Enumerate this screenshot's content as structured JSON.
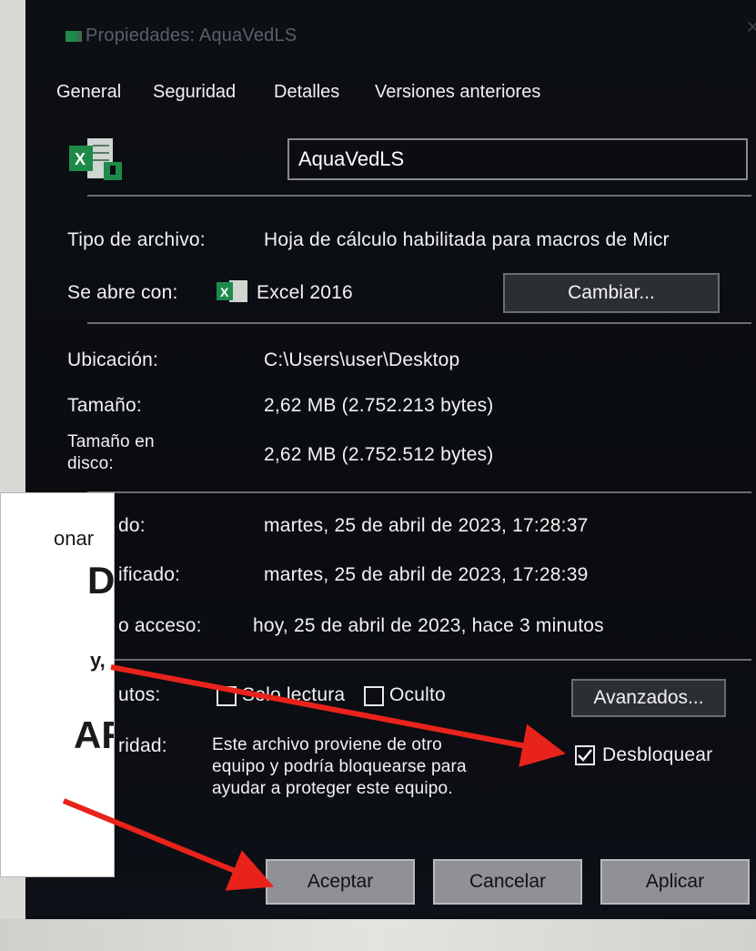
{
  "window": {
    "title": "Propiedades: AquaVedLS",
    "close_glyph": "×"
  },
  "tabs": [
    "General",
    "Seguridad",
    "Detalles",
    "Versiones anteriores"
  ],
  "file": {
    "name": "AquaVedLS",
    "type_label": "Tipo de archivo:",
    "type_value": "Hoja de cálculo habilitada para macros de Micr",
    "opens_label": "Se abre con:",
    "opens_value": "Excel 2016",
    "change_button": "Cambiar..."
  },
  "location": {
    "location_label": "Ubicación:",
    "location_value": "C:\\Users\\user\\Desktop",
    "size_label": "Tamaño:",
    "size_value": "2,62 MB (2.752.213 bytes)",
    "disk_label_line1": "Tamaño en",
    "disk_label_line2": "disco:",
    "disk_value": "2,62 MB (2.752.512 bytes)"
  },
  "dates": {
    "created_label_fragment": "do:",
    "created_value": "martes, 25 de abril de 2023, 17:28:37",
    "modified_label_fragment": "ificado:",
    "modified_value": "martes, 25 de abril de 2023, 17:28:39",
    "accessed_label_fragment": "o acceso:",
    "accessed_value": "hoy, 25 de abril de 2023, hace 3 minutos"
  },
  "attributes": {
    "label_fragment": "utos:",
    "readonly_label": "Solo lectura",
    "hidden_label": "Oculto",
    "advanced_button": "Avanzados..."
  },
  "security": {
    "label_fragment": "ridad:",
    "message_line1": "Este archivo proviene de otro",
    "message_line2": "equipo y podría bloquearse para",
    "message_line3": "ayudar a proteger este equipo.",
    "unblock_label": "Desbloquear",
    "unblock_checked": true
  },
  "footer": {
    "ok_button": "Aceptar",
    "cancel_button": "Cancelar",
    "apply_button": "Aplicar"
  },
  "overlay": {
    "line1": "onar",
    "line2": "D-",
    "line3": "y,",
    "line4": "AR"
  },
  "colors": {
    "annotation_arrow": "#e8231b",
    "excel_green": "#1e8a4a"
  }
}
